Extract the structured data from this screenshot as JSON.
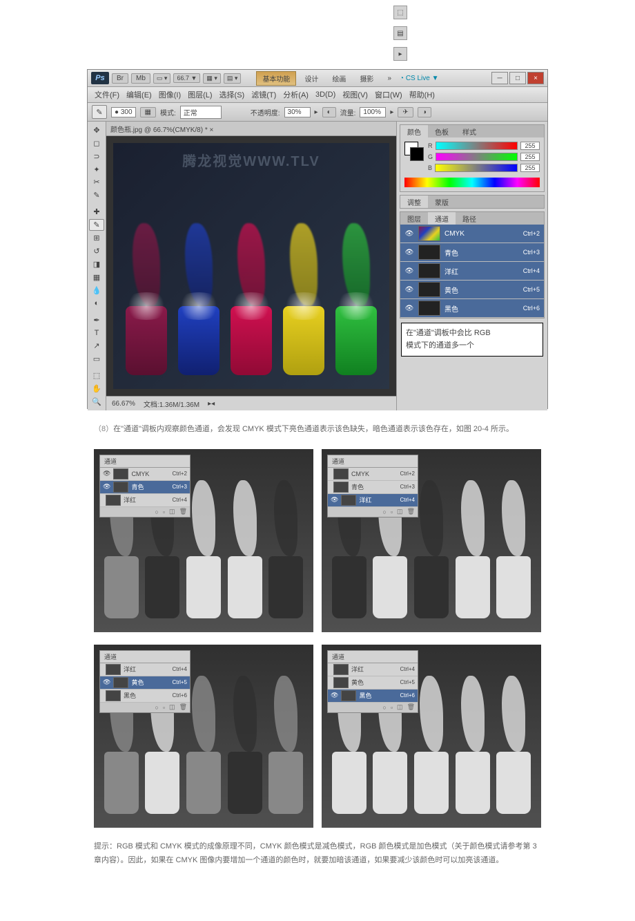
{
  "app": {
    "logo": "Ps",
    "header_btns": [
      "Br",
      "Mb"
    ],
    "zoom": "66.7 ▼",
    "workspace_tabs": [
      "基本功能",
      "设计",
      "绘画",
      "摄影"
    ],
    "more": "»",
    "cslive": "CS Live ▼",
    "window_controls": {
      "min": "─",
      "max": "□",
      "close": "×"
    }
  },
  "menu": {
    "file": "文件(F)",
    "edit": "编辑(E)",
    "image": "图像(I)",
    "layer": "图层(L)",
    "select": "选择(S)",
    "filter": "滤镜(T)",
    "analysis": "分析(A)",
    "threed": "3D(D)",
    "view": "视图(V)",
    "window": "窗口(W)",
    "help": "帮助(H)"
  },
  "options": {
    "brush_size": "300",
    "mode_label": "模式:",
    "mode_value": "正常",
    "opacity_label": "不透明度:",
    "opacity_value": "30%",
    "flow_label": "流量:",
    "flow_value": "100%"
  },
  "document": {
    "tab": "颜色瓶.jpg @ 66.7%(CMYK/8) * ×",
    "watermark": "腾龙视觉WWW.TLV",
    "zoom": "66.67%",
    "filesize": "文档:1.36M/1.36M"
  },
  "color_panel": {
    "tabs": [
      "颜色",
      "色板",
      "样式"
    ],
    "r": "R",
    "g": "G",
    "b": "B",
    "r_val": "255",
    "g_val": "255",
    "b_val": "255"
  },
  "adjustment_panel": {
    "tabs": [
      "调整",
      "蒙版"
    ]
  },
  "channels_panel": {
    "tabs": [
      "图层",
      "通道",
      "路径"
    ],
    "cmyk": "CMYK",
    "cyan": "青色",
    "magenta": "洋红",
    "yellow": "黄色",
    "black": "黑色",
    "sc_cmyk": "Ctrl+2",
    "sc_c": "Ctrl+3",
    "sc_m": "Ctrl+4",
    "sc_y": "Ctrl+5",
    "sc_k": "Ctrl+6"
  },
  "note": {
    "line1": "在\"通道\"调板中会比 RGB",
    "line2": "模式下的通道多一个"
  },
  "caption1": {
    "num": "（8）",
    "text": "在\"通道\"调板内观察颜色通道，会发现 CMYK 模式下亮色通道表示该色缺失，暗色通道表示该色存在，如图 20-4 所示。"
  },
  "mini": {
    "tab": "通道",
    "cmyk": "CMYK",
    "cyan": "青色",
    "magenta": "洋红",
    "yellow": "黄色",
    "black": "黑色",
    "sc2": "Ctrl+2",
    "sc3": "Ctrl+3",
    "sc4": "Ctrl+4",
    "sc5": "Ctrl+5",
    "sc6": "Ctrl+6"
  },
  "caption2": {
    "prefix": "提示：",
    "text": "RGB 模式和 CMYK 模式的成像原理不同，CMYK 颜色模式是减色模式，RGB 颜色模式是加色模式（关于颜色模式请参考第 3 章内容）。因此，如果在 CMYK 图像内要增加一个通道的颜色时，就要加暗该通道，如果要减少该颜色时可以加亮该通道。"
  }
}
